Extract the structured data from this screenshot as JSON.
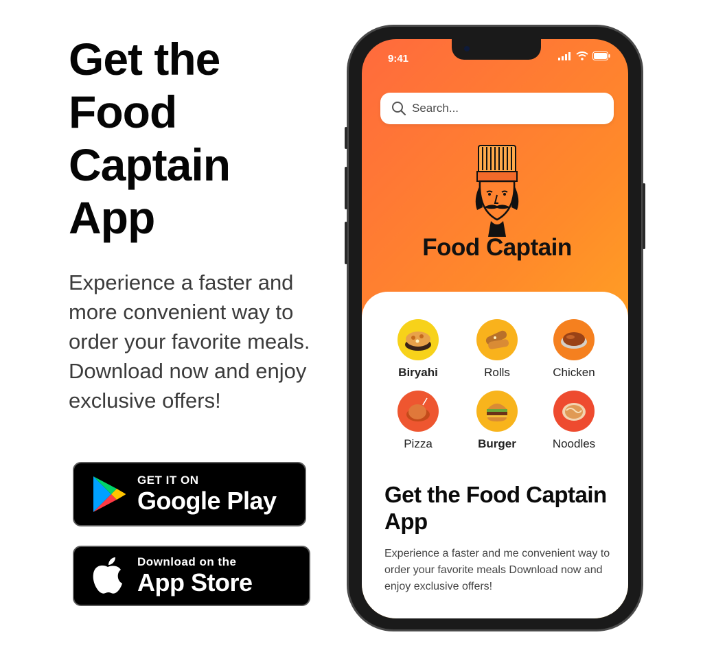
{
  "hero": {
    "title": "Get the Food Captain App",
    "description": "Experience a faster and more convenient way to order your favorite meals. Download now and enjoy exclusive offers!"
  },
  "stores": {
    "google_small": "GET IT ON",
    "google_big": "Google Play",
    "apple_small": "Download on the",
    "apple_big": "App Store"
  },
  "phone": {
    "time": "9:41",
    "search_placeholder": "Search...",
    "brand_name": "Food Captain",
    "categories": [
      {
        "label": "Biryahi",
        "icon": "biryani-icon",
        "color": "#f7d21a"
      },
      {
        "label": "Rolls",
        "icon": "rolls-icon",
        "color": "#f9b21c"
      },
      {
        "label": "Chicken",
        "icon": "chicken-icon",
        "color": "#f5801f"
      },
      {
        "label": "Pizza",
        "icon": "pizza-icon",
        "color": "#ee5630"
      },
      {
        "label": "Burger",
        "icon": "burger-icon",
        "color": "#f8b41c"
      },
      {
        "label": "Noodles",
        "icon": "noodles-icon",
        "color": "#ee4b2f"
      }
    ],
    "sheet_title": "Get the Food Captain App",
    "sheet_description": "Experience a faster and me convenient way to order your favorite meals Download now and enjoy exclusive offers!"
  },
  "colors": {
    "gradient_start": "#ff6a3d",
    "gradient_end": "#ffc21a",
    "store_bg": "#000000"
  }
}
